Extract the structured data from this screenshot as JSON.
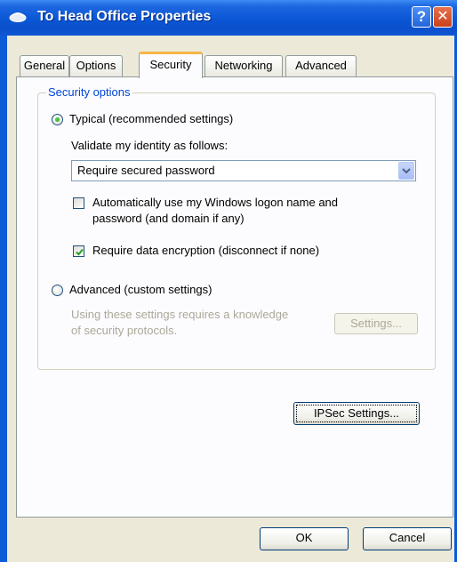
{
  "window": {
    "title": "To Head Office Properties",
    "help_glyph": "?",
    "close_glyph": "✕",
    "icon": "phone-connection-icon"
  },
  "tabs": [
    {
      "label": "General",
      "active": false
    },
    {
      "label": "Options",
      "active": false
    },
    {
      "label": "Security",
      "active": true
    },
    {
      "label": "Networking",
      "active": false
    },
    {
      "label": "Advanced",
      "active": false
    }
  ],
  "security": {
    "group_label": "Security options",
    "typical": {
      "label": "Typical (recommended settings)",
      "selected": true
    },
    "validate_label": "Validate my identity as follows:",
    "validate_select": {
      "value": "Require secured password"
    },
    "auto_logon": {
      "line1": "Automatically use my Windows logon name and",
      "line2": "password (and domain if any)",
      "checked": false
    },
    "encryption": {
      "label": "Require data encryption (disconnect if none)",
      "checked": true
    },
    "advanced": {
      "label": "Advanced (custom settings)",
      "selected": false
    },
    "advanced_note": {
      "line1": "Using these settings requires a knowledge",
      "line2": "of security protocols."
    },
    "settings_button": "Settings...",
    "ipsec_button": "IPSec Settings..."
  },
  "footer": {
    "ok_label": "OK",
    "cancel_label": "Cancel"
  },
  "colors": {
    "titlebar": "#0a57d6",
    "dialog_bg": "#ece9d8",
    "group_title": "#0046d5",
    "active_tab_accent": "#f7b548",
    "disabled_text": "#aca899"
  }
}
